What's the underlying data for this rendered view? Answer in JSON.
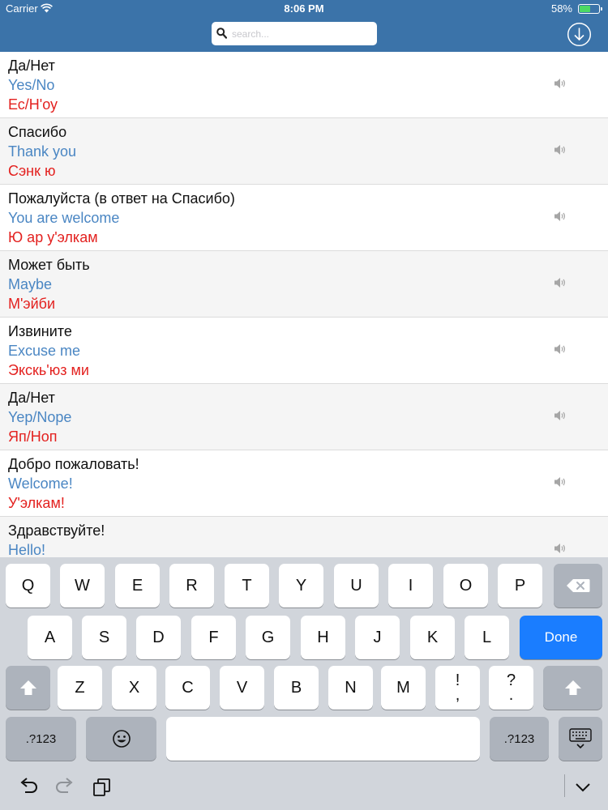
{
  "status_bar": {
    "carrier": "Carrier",
    "time": "8:06 PM",
    "battery": "58%",
    "battery_level": 0.58
  },
  "search": {
    "placeholder": "search..."
  },
  "phrases": [
    {
      "ru": "Да/Нет",
      "en": "Yes/No",
      "pron": "Ес/Н'оу"
    },
    {
      "ru": "Спасибо",
      "en": "Thank you",
      "pron": "Сэнк ю"
    },
    {
      "ru": "Пожалуйста (в ответ на Спасибо)",
      "en": "You are welcome",
      "pron": "Ю ар у'элкам"
    },
    {
      "ru": "Может быть",
      "en": "Maybe",
      "pron": "М'эйби"
    },
    {
      "ru": "Извините",
      "en": "Excuse me",
      "pron": "Экскь'юз ми"
    },
    {
      "ru": "Да/Нет",
      "en": "Yep/Nope",
      "pron": "Яп/Ноп"
    },
    {
      "ru": "Добро пожаловать!",
      "en": "Welcome!",
      "pron": "У'элкам!"
    },
    {
      "ru": "Здравствуйте!",
      "en": "Hello!",
      "pron": ""
    }
  ],
  "keyboard": {
    "row1": [
      "Q",
      "W",
      "E",
      "R",
      "T",
      "Y",
      "U",
      "I",
      "O",
      "P"
    ],
    "row2": [
      "A",
      "S",
      "D",
      "F",
      "G",
      "H",
      "J",
      "K",
      "L"
    ],
    "row3": [
      "Z",
      "X",
      "C",
      "V",
      "B",
      "N",
      "M"
    ],
    "exclaim_top": "!",
    "exclaim_bottom": ",",
    "question_top": "?",
    "question_bottom": ".",
    "done_label": "Done",
    "numbers_label": ".?123",
    "icons": [
      "backspace-icon",
      "shift-icon",
      "emoji-icon",
      "keyboard-hide-icon",
      "undo-icon",
      "redo-icon",
      "paste-icon",
      "chevron-down-icon"
    ]
  },
  "colors": {
    "header": "#3b73a9",
    "russian": "#111111",
    "english": "#4a86c3",
    "pronunciation": "#e3211f",
    "done_key": "#1a7dff"
  }
}
